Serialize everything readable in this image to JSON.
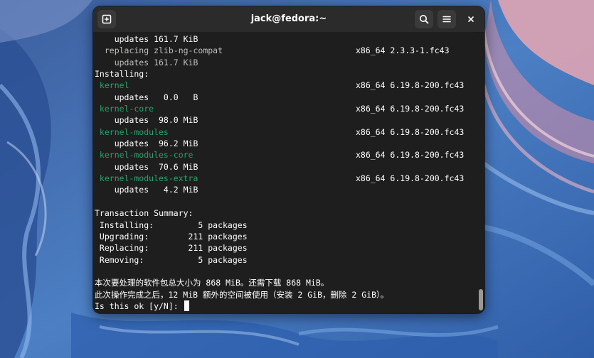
{
  "window": {
    "title": "jack@fedora:~"
  },
  "terminal": {
    "lines": [
      {
        "text": "    updates 161.7 KiB"
      },
      {
        "name": "  replacing zlib-ng-compat",
        "name_kind": "dim",
        "info": "x86_64 2.3.3-1.fc43",
        "pad": 53
      },
      {
        "text": "    updates 161.7 KiB",
        "kind": "dim"
      },
      {
        "text": "Installing:"
      },
      {
        "name": " kernel",
        "name_kind": "pkg",
        "info": "x86_64 6.19.8-200.fc43",
        "pad": 53
      },
      {
        "text": "    updates   0.0   B"
      },
      {
        "name": " kernel-core",
        "name_kind": "pkg",
        "info": "x86_64 6.19.8-200.fc43",
        "pad": 53
      },
      {
        "text": "    updates  98.0 MiB"
      },
      {
        "name": " kernel-modules",
        "name_kind": "pkg",
        "info": "x86_64 6.19.8-200.fc43",
        "pad": 53
      },
      {
        "text": "    updates  96.2 MiB"
      },
      {
        "name": " kernel-modules-core",
        "name_kind": "pkg",
        "info": "x86_64 6.19.8-200.fc43",
        "pad": 53
      },
      {
        "text": "    updates  70.6 MiB"
      },
      {
        "name": " kernel-modules-extra",
        "name_kind": "pkg",
        "info": "x86_64 6.19.8-200.fc43",
        "pad": 53
      },
      {
        "text": "    updates   4.2 MiB"
      },
      {
        "text": ""
      },
      {
        "text": "Transaction Summary:"
      },
      {
        "text": " Installing:         5 packages"
      },
      {
        "text": " Upgrading:        211 packages"
      },
      {
        "text": " Replacing:        211 packages"
      },
      {
        "text": " Removing:           5 packages"
      },
      {
        "text": ""
      },
      {
        "text": "本次要处理的软件包总大小为 868 MiB。还需下载 868 MiB。"
      },
      {
        "text": "此次操作完成之后，12 MiB 额外的空间被使用（安装 2 GiB，删除 2 GiB）。"
      },
      {
        "text": "Is this ok [y/N]: ",
        "cursor": true
      }
    ]
  },
  "icons": {
    "new_tab": "new-tab-icon",
    "search": "search-icon",
    "menu": "hamburger-menu-icon",
    "close": "close-icon"
  },
  "colors": {
    "terminal_bg": "#1e1e1e",
    "titlebar_bg": "#2b2b2b",
    "package_green": "#26a269",
    "dim_text": "#c0bfbc"
  }
}
